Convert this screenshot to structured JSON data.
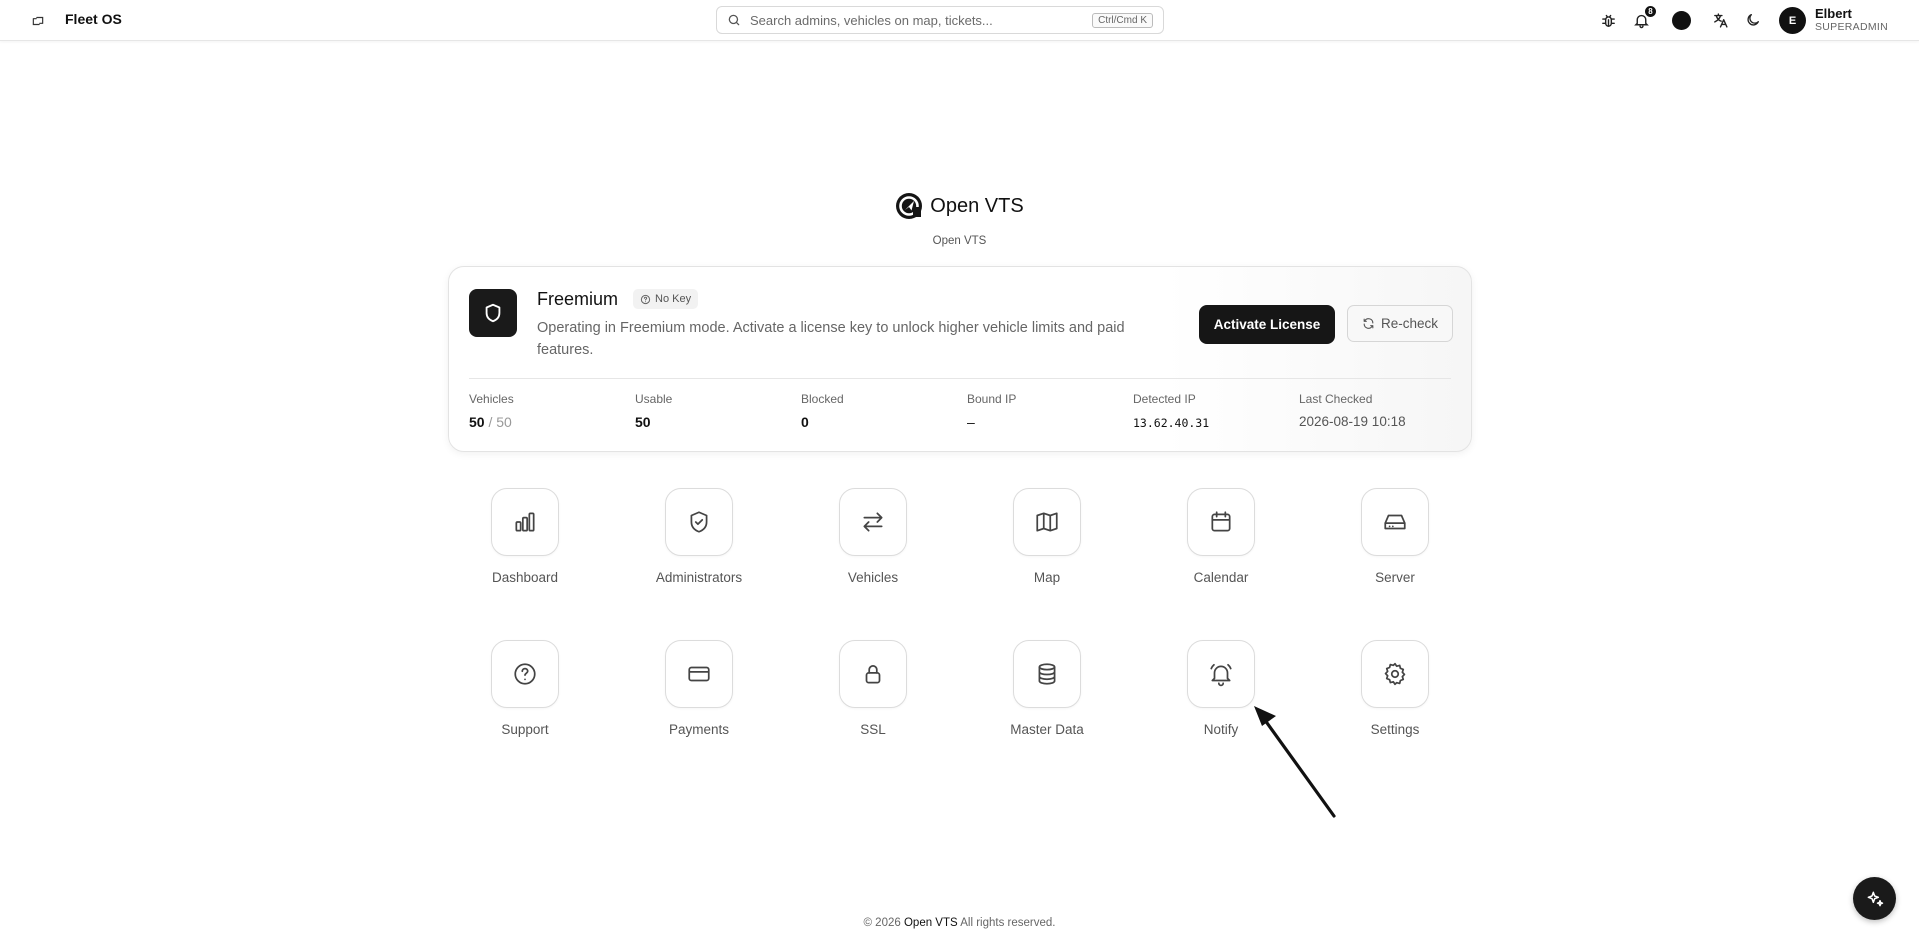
{
  "header": {
    "app_name": "Fleet OS",
    "search_placeholder": "Search admins, vehicles on map, tickets...",
    "search_shortcut": "Ctrl/Cmd K",
    "notification_count": "8",
    "user_initial": "E",
    "user_name": "Elbert",
    "user_role": "SUPERADMIN",
    "icons": [
      "sidebar-toggle-icon",
      "search-icon",
      "bug-icon",
      "bell-icon",
      "theme-color-icon",
      "language-icon",
      "moon-icon"
    ]
  },
  "brand": {
    "name": "Open VTS",
    "subtitle": "Open VTS"
  },
  "license": {
    "plan": "Freemium",
    "badge": "No Key",
    "description": "Operating in Freemium mode. Activate a license key to unlock higher vehicle limits and paid features.",
    "activate_label": "Activate License",
    "recheck_label": "Re-check",
    "stats": {
      "vehicles": {
        "label": "Vehicles",
        "value": "50",
        "total": "/ 50"
      },
      "usable": {
        "label": "Usable",
        "value": "50"
      },
      "blocked": {
        "label": "Blocked",
        "value": "0"
      },
      "bound_ip": {
        "label": "Bound IP",
        "value": "–"
      },
      "detected_ip": {
        "label": "Detected IP",
        "value": "13.62.40.31"
      },
      "last_checked": {
        "label": "Last Checked",
        "value": "2026-08-19 10:18"
      }
    }
  },
  "apps": {
    "dashboard": "Dashboard",
    "administrators": "Administrators",
    "vehicles": "Vehicles",
    "map": "Map",
    "calendar": "Calendar",
    "server": "Server",
    "support": "Support",
    "payments": "Payments",
    "ssl": "SSL",
    "master_data": "Master Data",
    "notify": "Notify",
    "settings": "Settings"
  },
  "footer": {
    "prefix": "© 2026",
    "brand": "Open VTS",
    "suffix": "All rights reserved."
  },
  "colors": {
    "primary": "#161616",
    "border": "#dcdcdc",
    "muted_text": "#666666"
  }
}
